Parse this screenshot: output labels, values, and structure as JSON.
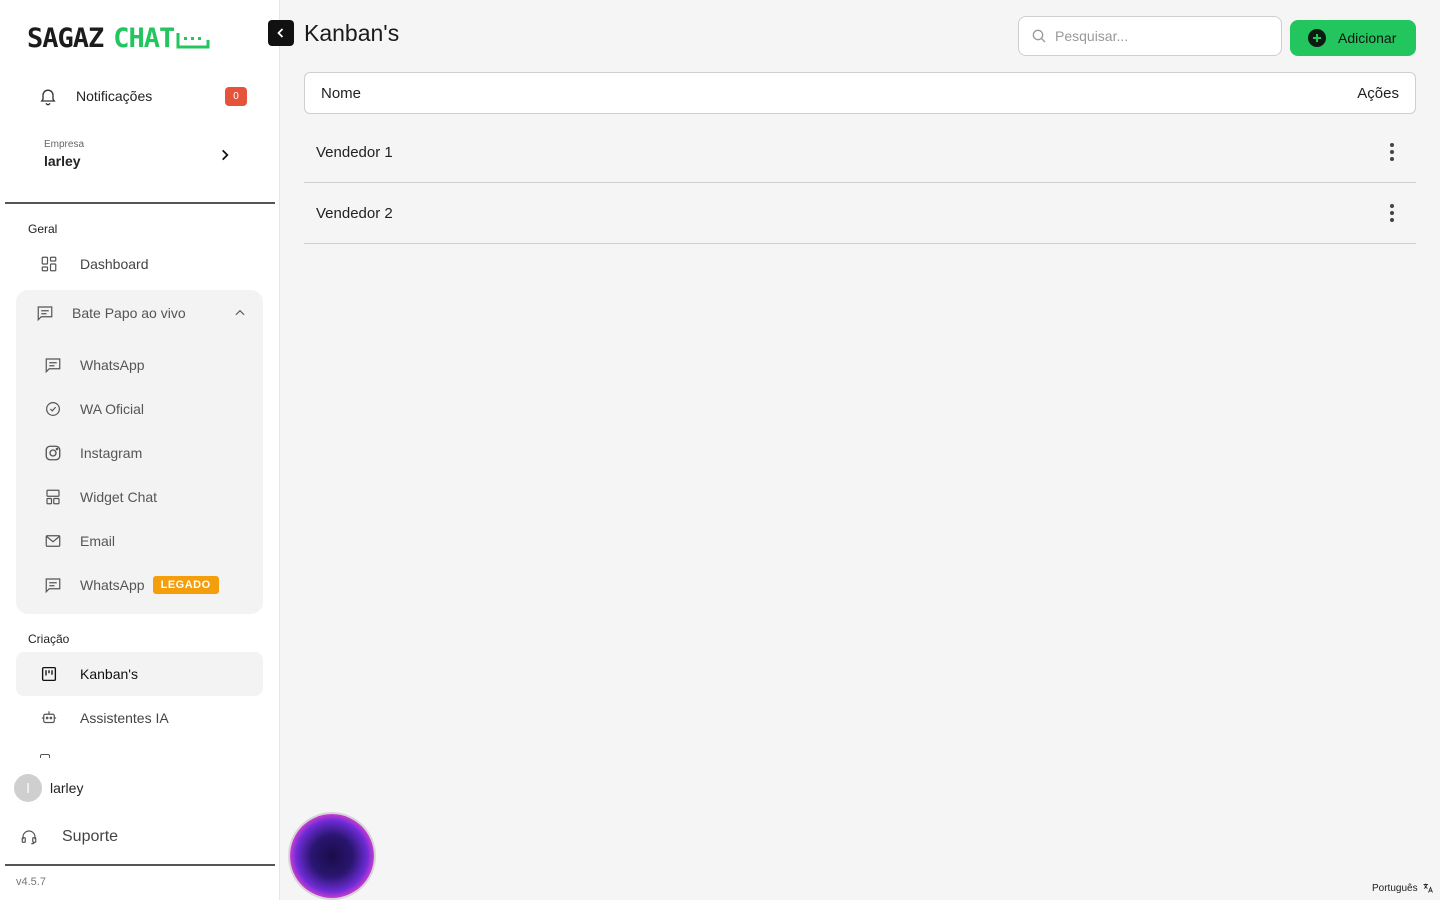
{
  "brand": {
    "word1": "SAGAZ",
    "word2": "CHAT",
    "accent": "#22c55e"
  },
  "sidebar": {
    "notifications": {
      "label": "Notificações",
      "count": "0"
    },
    "company": {
      "caption": "Empresa",
      "name": "larley"
    },
    "sections": {
      "geral": "Geral",
      "criacao": "Criação"
    },
    "dashboard": "Dashboard",
    "live_chat": {
      "label": "Bate Papo ao vivo",
      "items": [
        {
          "label": "WhatsApp",
          "icon": "chat-icon"
        },
        {
          "label": "WA Oficial",
          "icon": "check-circle-icon"
        },
        {
          "label": "Instagram",
          "icon": "instagram-icon"
        },
        {
          "label": "Widget Chat",
          "icon": "widget-icon"
        },
        {
          "label": "Email",
          "icon": "mail-icon"
        },
        {
          "label": "WhatsApp",
          "icon": "chat-icon",
          "badge": "LEGADO"
        }
      ]
    },
    "kanbans": "Kanban's",
    "assistants": "Assistentes IA",
    "user": {
      "initial": "l",
      "name": "larley"
    },
    "support": "Suporte",
    "version": "v4.5.7"
  },
  "main": {
    "title": "Kanban's",
    "search_placeholder": "Pesquisar...",
    "add_label": "Adicionar",
    "table": {
      "headers": {
        "name": "Nome",
        "actions": "Ações"
      },
      "rows": [
        "Vendedor 1",
        "Vendedor 2"
      ]
    }
  },
  "footer": {
    "language": "Português"
  }
}
